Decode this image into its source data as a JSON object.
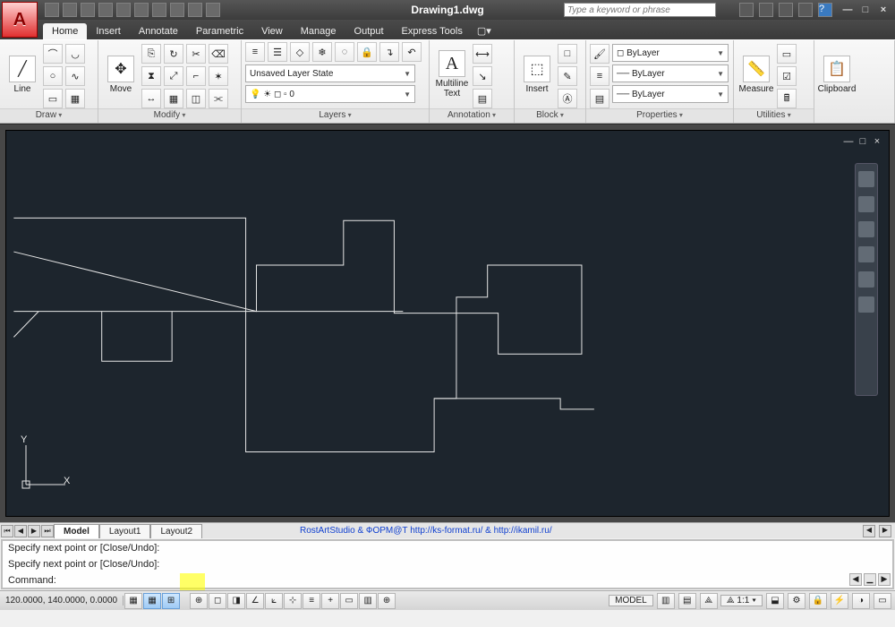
{
  "title": "Drawing1.dwg",
  "search_placeholder": "Type a keyword or phrase",
  "tabs": [
    "Home",
    "Insert",
    "Annotate",
    "Parametric",
    "View",
    "Manage",
    "Output",
    "Express Tools"
  ],
  "active_tab": 0,
  "ribbon": {
    "draw": {
      "title": "Draw",
      "big": "Line"
    },
    "modify": {
      "title": "Modify",
      "big": "Move"
    },
    "layers": {
      "title": "Layers",
      "state": "Unsaved Layer State",
      "current": "0"
    },
    "annotation": {
      "title": "Annotation",
      "big": "Multiline Text"
    },
    "block": {
      "title": "Block",
      "big": "Insert"
    },
    "properties": {
      "title": "Properties",
      "color": "ByLayer",
      "ltype": "ByLayer",
      "lweight": "ByLayer"
    },
    "utilities": {
      "title": "Utilities",
      "big": "Measure"
    },
    "clipboard": {
      "title": "Clipboard",
      "big": "Clipboard"
    }
  },
  "sheet_tabs": [
    "Model",
    "Layout1",
    "Layout2"
  ],
  "sheet_link": "RostArtStudio & ФОРМ@Т http://ks-format.ru/ & http://ikamil.ru/",
  "cmd": {
    "l1": "Specify next point or [Close/Undo]:",
    "l2": "Specify next point or [Close/Undo]:",
    "prompt": "Command:"
  },
  "status": {
    "coords": "120.0000, 140.0000, 0.0000",
    "model": "MODEL",
    "scale": "1:1"
  }
}
